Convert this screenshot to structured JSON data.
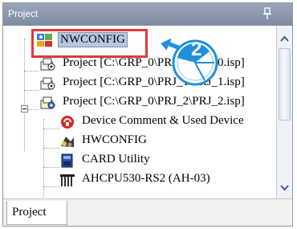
{
  "panel": {
    "title": "Project"
  },
  "tree": {
    "items": [
      {
        "label": "NWCONFIG",
        "icon": "nwconfig-icon"
      },
      {
        "label": "Project [C:\\GRP_0\\PRJ_0\\PRJ_0.isp]",
        "icon": "project-icon"
      },
      {
        "label": "Project [C:\\GRP_0\\PRJ_1\\PRJ_1.isp]",
        "icon": "project-icon"
      },
      {
        "label": "Project [C:\\GRP_0\\PRJ_2\\PRJ_2.isp]",
        "icon": "project-icon"
      },
      {
        "label": "Device Comment & Used Device",
        "icon": "device-comment-icon"
      },
      {
        "label": "HWCONFIG",
        "icon": "hwconfig-icon"
      },
      {
        "label": "CARD Utility",
        "icon": "card-utility-icon"
      },
      {
        "label": "AHCPU530-RS2 (AH-03)",
        "icon": "cpu-module-icon"
      }
    ]
  },
  "annotation": {
    "text": "x2",
    "number": "2"
  },
  "tabs": [
    {
      "label": "Project"
    }
  ],
  "colors": {
    "highlight": "#e03a3a",
    "badge": "#1f8fe0",
    "titlebar": "#8a96aa"
  }
}
